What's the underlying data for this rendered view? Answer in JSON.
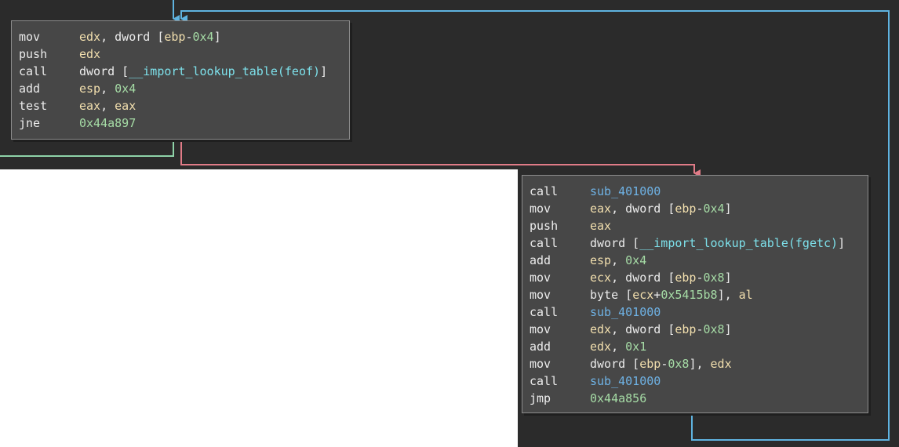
{
  "colors": {
    "canvas_background": "#2b2b2b",
    "block_background": "#474747",
    "edge_blue": "#5fb3e0",
    "edge_green": "#8ed3a8",
    "edge_red": "#e07b87",
    "register": "#f2dfae",
    "number": "#a6dca6",
    "import": "#7de0ea",
    "subroutine": "#6fb3e6"
  },
  "edges": [
    {
      "name": "edge-loop-back",
      "color": "blue",
      "direction": "into block-a"
    },
    {
      "name": "edge-true-branch",
      "color": "green",
      "direction": "out of block-a"
    },
    {
      "name": "edge-false-branch",
      "color": "red",
      "direction": "block-a to block-b"
    }
  ],
  "block_a": {
    "lines": [
      {
        "mnemonic": "mov",
        "tokens": [
          {
            "t": "edx",
            "k": "reg"
          },
          {
            "t": ", dword [",
            "k": "plain"
          },
          {
            "t": "ebp",
            "k": "reg"
          },
          {
            "t": "-",
            "k": "plain"
          },
          {
            "t": "0x4",
            "k": "num"
          },
          {
            "t": "]",
            "k": "plain"
          }
        ]
      },
      {
        "mnemonic": "push",
        "tokens": [
          {
            "t": "edx",
            "k": "reg"
          }
        ]
      },
      {
        "mnemonic": "call",
        "tokens": [
          {
            "t": "dword [",
            "k": "plain"
          },
          {
            "t": "__import_lookup_table(feof)",
            "k": "imp"
          },
          {
            "t": "]",
            "k": "plain"
          }
        ]
      },
      {
        "mnemonic": "add",
        "tokens": [
          {
            "t": "esp",
            "k": "reg"
          },
          {
            "t": ", ",
            "k": "plain"
          },
          {
            "t": "0x4",
            "k": "num"
          }
        ]
      },
      {
        "mnemonic": "test",
        "tokens": [
          {
            "t": "eax",
            "k": "reg"
          },
          {
            "t": ", ",
            "k": "plain"
          },
          {
            "t": "eax",
            "k": "reg"
          }
        ]
      },
      {
        "mnemonic": "jne",
        "tokens": [
          {
            "t": "0x44a897",
            "k": "num"
          }
        ]
      }
    ]
  },
  "block_b": {
    "lines": [
      {
        "mnemonic": "call",
        "tokens": [
          {
            "t": "sub_401000",
            "k": "sub"
          }
        ]
      },
      {
        "mnemonic": "mov",
        "tokens": [
          {
            "t": "eax",
            "k": "reg"
          },
          {
            "t": ", dword [",
            "k": "plain"
          },
          {
            "t": "ebp",
            "k": "reg"
          },
          {
            "t": "-",
            "k": "plain"
          },
          {
            "t": "0x4",
            "k": "num"
          },
          {
            "t": "]",
            "k": "plain"
          }
        ]
      },
      {
        "mnemonic": "push",
        "tokens": [
          {
            "t": "eax",
            "k": "reg"
          }
        ]
      },
      {
        "mnemonic": "call",
        "tokens": [
          {
            "t": "dword [",
            "k": "plain"
          },
          {
            "t": "__import_lookup_table(fgetc)",
            "k": "imp"
          },
          {
            "t": "]",
            "k": "plain"
          }
        ]
      },
      {
        "mnemonic": "add",
        "tokens": [
          {
            "t": "esp",
            "k": "reg"
          },
          {
            "t": ", ",
            "k": "plain"
          },
          {
            "t": "0x4",
            "k": "num"
          }
        ]
      },
      {
        "mnemonic": "mov",
        "tokens": [
          {
            "t": "ecx",
            "k": "reg"
          },
          {
            "t": ", dword [",
            "k": "plain"
          },
          {
            "t": "ebp",
            "k": "reg"
          },
          {
            "t": "-",
            "k": "plain"
          },
          {
            "t": "0x8",
            "k": "num"
          },
          {
            "t": "]",
            "k": "plain"
          }
        ]
      },
      {
        "mnemonic": "mov",
        "tokens": [
          {
            "t": "byte [",
            "k": "plain"
          },
          {
            "t": "ecx",
            "k": "reg"
          },
          {
            "t": "+",
            "k": "plain"
          },
          {
            "t": "0x5415b8",
            "k": "num"
          },
          {
            "t": "], ",
            "k": "plain"
          },
          {
            "t": "al",
            "k": "reg"
          }
        ]
      },
      {
        "mnemonic": "call",
        "tokens": [
          {
            "t": "sub_401000",
            "k": "sub"
          }
        ]
      },
      {
        "mnemonic": "mov",
        "tokens": [
          {
            "t": "edx",
            "k": "reg"
          },
          {
            "t": ", dword [",
            "k": "plain"
          },
          {
            "t": "ebp",
            "k": "reg"
          },
          {
            "t": "-",
            "k": "plain"
          },
          {
            "t": "0x8",
            "k": "num"
          },
          {
            "t": "]",
            "k": "plain"
          }
        ]
      },
      {
        "mnemonic": "add",
        "tokens": [
          {
            "t": "edx",
            "k": "reg"
          },
          {
            "t": ", ",
            "k": "plain"
          },
          {
            "t": "0x1",
            "k": "num"
          }
        ]
      },
      {
        "mnemonic": "mov",
        "tokens": [
          {
            "t": "dword [",
            "k": "plain"
          },
          {
            "t": "ebp",
            "k": "reg"
          },
          {
            "t": "-",
            "k": "plain"
          },
          {
            "t": "0x8",
            "k": "num"
          },
          {
            "t": "], ",
            "k": "plain"
          },
          {
            "t": "edx",
            "k": "reg"
          }
        ]
      },
      {
        "mnemonic": "call",
        "tokens": [
          {
            "t": "sub_401000",
            "k": "sub"
          }
        ]
      },
      {
        "mnemonic": "jmp",
        "tokens": [
          {
            "t": "0x44a856",
            "k": "num"
          }
        ]
      }
    ]
  }
}
